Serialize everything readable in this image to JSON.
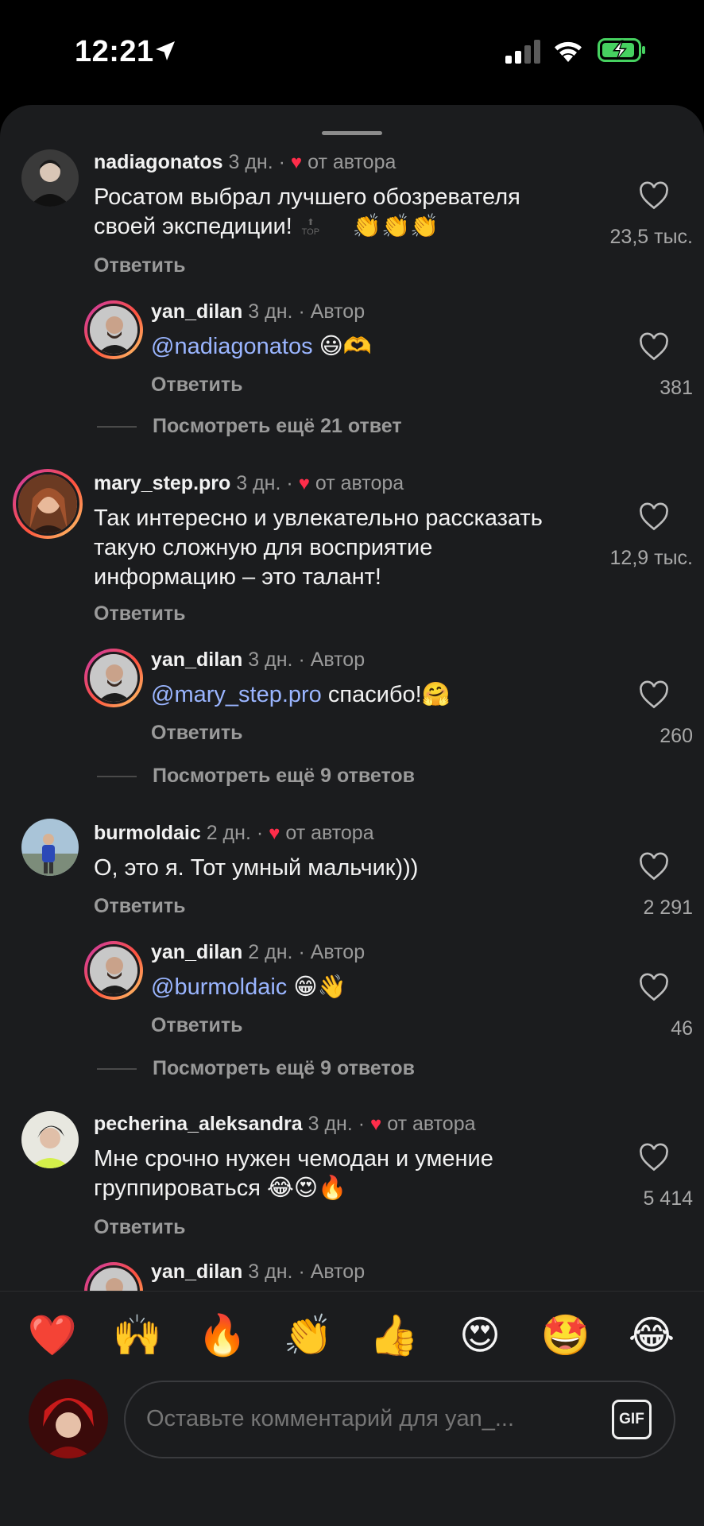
{
  "status_bar": {
    "time": "12:21"
  },
  "comments": [
    {
      "username": "nadiagonatos",
      "age": "3 дн.",
      "sep": "·",
      "badge": "от автора",
      "text": "Росатом выбрал лучшего обозревателя своей экспедиции!",
      "emoji": "👏👏👏",
      "top_label": "TOP",
      "reply_label": "Ответить",
      "likes": "23,5 тыс.",
      "reply": {
        "username": "yan_dilan",
        "age": "3 дн.",
        "role": "· Автор",
        "mention": "@nadiagonatos",
        "text": "😃🫶",
        "reply_label": "Ответить",
        "likes": "381"
      },
      "more": "Посмотреть ещё 21 ответ"
    },
    {
      "username": "mary_step.pro",
      "age": "3 дн.",
      "sep": "·",
      "badge": "от автора",
      "text": "Так интересно и увлекательно рассказать такую сложную для восприятие информацию – это талант!",
      "reply_label": "Ответить",
      "likes": "12,9 тыс.",
      "reply": {
        "username": "yan_dilan",
        "age": "3 дн.",
        "role": "· Автор",
        "mention": "@mary_step.pro",
        "text": "спасибо!🤗",
        "reply_label": "Ответить",
        "likes": "260"
      },
      "more": "Посмотреть ещё 9 ответов"
    },
    {
      "username": "burmoldaic",
      "age": "2 дн.",
      "sep": "·",
      "badge": "от автора",
      "text": "О, это я. Тот умный мальчик)))",
      "reply_label": "Ответить",
      "likes": "2 291",
      "reply": {
        "username": "yan_dilan",
        "age": "2 дн.",
        "role": "· Автор",
        "mention": "@burmoldaic",
        "text": "😁👋",
        "reply_label": "Ответить",
        "likes": "46"
      },
      "more": "Посмотреть ещё 9 ответов"
    },
    {
      "username": "pecherina_aleksandra",
      "age": "3 дн.",
      "sep": "·",
      "badge": "от автора",
      "text": "Мне срочно нужен чемодан и умение группироваться 😂😍🔥",
      "reply_label": "Ответить",
      "likes": "5 414",
      "reply": {
        "username": "yan_dilan",
        "age": "3 дн.",
        "role": "· Автор"
      }
    }
  ],
  "emoji_bar": [
    "❤️",
    "🙌",
    "🔥",
    "👏",
    "👍",
    "😍",
    "🤩",
    "😂"
  ],
  "composer": {
    "placeholder": "Оставьте комментарий для yan_...",
    "gif_label": "GIF"
  },
  "colors": {
    "background": "#1b1c1e",
    "mention": "#9ab5ff",
    "heart": "#ff2d4a"
  }
}
